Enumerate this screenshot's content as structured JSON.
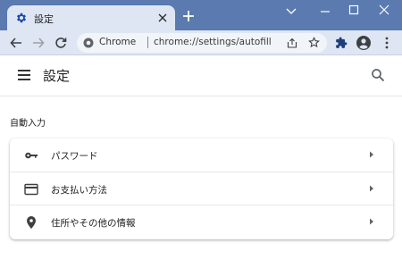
{
  "window": {
    "tab_title": "設定",
    "new_tab_label": "+",
    "controls": {
      "dropdown": "⌄",
      "minimize": "—",
      "maximize": "☐",
      "close": "✕"
    }
  },
  "toolbar": {
    "site_chip": "Chrome",
    "url": "chrome://settings/autofill"
  },
  "header": {
    "title": "設定"
  },
  "section": {
    "heading": "自動入力",
    "items": [
      {
        "label": "パスワード",
        "icon": "key-icon"
      },
      {
        "label": "お支払い方法",
        "icon": "credit-card-icon"
      },
      {
        "label": "住所やその他の情報",
        "icon": "location-pin-icon"
      }
    ]
  },
  "colors": {
    "titlebar": "#5a7ab0",
    "toolbar": "#dfe6f3",
    "accent_dark": "#3c4043"
  }
}
